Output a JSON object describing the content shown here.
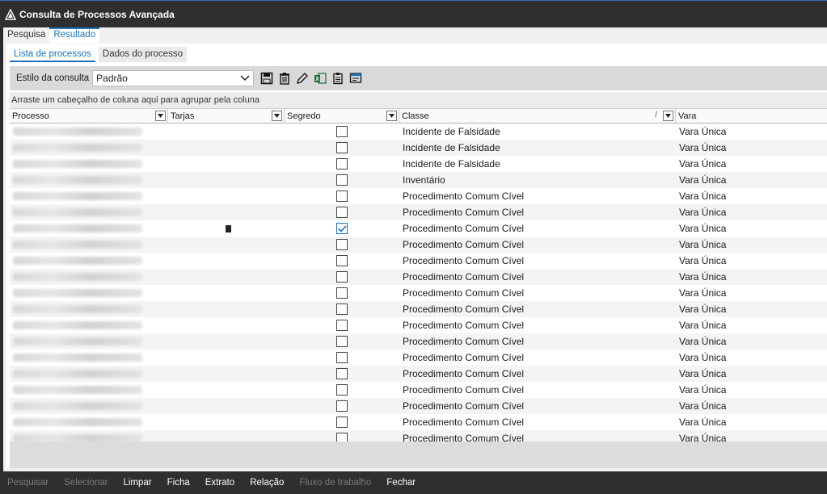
{
  "window": {
    "title": "Consulta de Processos Avançada"
  },
  "tabs": [
    {
      "label": "Pesquisa",
      "active": false
    },
    {
      "label": "Resultado",
      "active": true
    }
  ],
  "subtabs": [
    {
      "label": "Lista de processos",
      "active": true
    },
    {
      "label": "Dados do processo",
      "active": false
    }
  ],
  "toolbar": {
    "style_label": "Estilo da consulta",
    "style_value": "Padrão",
    "icons": [
      "save-icon",
      "trash-icon",
      "pencil-icon",
      "excel-export-icon",
      "clipboard-icon",
      "window-config-icon"
    ]
  },
  "grid": {
    "group_hint": "Arraste um cabeçalho de coluna aqui para agrupar pela coluna",
    "columns": [
      "Processo",
      "Tarjas",
      "Segredo",
      "Classe",
      "Vara"
    ],
    "rows": [
      {
        "classe": "Incidente de Falsidade",
        "vara": "Vara Única",
        "segredo": false,
        "tarja": false
      },
      {
        "classe": "Incidente de Falsidade",
        "vara": "Vara Única",
        "segredo": false,
        "tarja": false
      },
      {
        "classe": "Incidente de Falsidade",
        "vara": "Vara Única",
        "segredo": false,
        "tarja": false
      },
      {
        "classe": "Inventário",
        "vara": "Vara Única",
        "segredo": false,
        "tarja": false
      },
      {
        "classe": "Procedimento Comum Cível",
        "vara": "Vara Única",
        "segredo": false,
        "tarja": false
      },
      {
        "classe": "Procedimento Comum Cível",
        "vara": "Vara Única",
        "segredo": false,
        "tarja": false
      },
      {
        "classe": "Procedimento Comum Cível",
        "vara": "Vara Única",
        "segredo": true,
        "tarja": true
      },
      {
        "classe": "Procedimento Comum Cível",
        "vara": "Vara Única",
        "segredo": false,
        "tarja": false
      },
      {
        "classe": "Procedimento Comum Cível",
        "vara": "Vara Única",
        "segredo": false,
        "tarja": false
      },
      {
        "classe": "Procedimento Comum Cível",
        "vara": "Vara Única",
        "segredo": false,
        "tarja": false
      },
      {
        "classe": "Procedimento Comum Cível",
        "vara": "Vara Única",
        "segredo": false,
        "tarja": false
      },
      {
        "classe": "Procedimento Comum Cível",
        "vara": "Vara Única",
        "segredo": false,
        "tarja": false
      },
      {
        "classe": "Procedimento Comum Cível",
        "vara": "Vara Única",
        "segredo": false,
        "tarja": false
      },
      {
        "classe": "Procedimento Comum Cível",
        "vara": "Vara Única",
        "segredo": false,
        "tarja": false
      },
      {
        "classe": "Procedimento Comum Cível",
        "vara": "Vara Única",
        "segredo": false,
        "tarja": false
      },
      {
        "classe": "Procedimento Comum Cível",
        "vara": "Vara Única",
        "segredo": false,
        "tarja": false
      },
      {
        "classe": "Procedimento Comum Cível",
        "vara": "Vara Única",
        "segredo": false,
        "tarja": false
      },
      {
        "classe": "Procedimento Comum Cível",
        "vara": "Vara Única",
        "segredo": false,
        "tarja": false
      },
      {
        "classe": "Procedimento Comum Cível",
        "vara": "Vara Única",
        "segredo": false,
        "tarja": false
      },
      {
        "classe": "Procedimento Comum Cível",
        "vara": "Vara Única",
        "segredo": false,
        "tarja": false
      }
    ]
  },
  "footer": [
    {
      "label": "Pesquisar",
      "enabled": false
    },
    {
      "label": "Selecionar",
      "enabled": false
    },
    {
      "label": "Limpar",
      "enabled": true
    },
    {
      "label": "Ficha",
      "enabled": true
    },
    {
      "label": "Extrato",
      "enabled": true
    },
    {
      "label": "Relação",
      "enabled": true
    },
    {
      "label": "Fluxo de trabalho",
      "enabled": false
    },
    {
      "label": "Fechar",
      "enabled": true
    }
  ]
}
